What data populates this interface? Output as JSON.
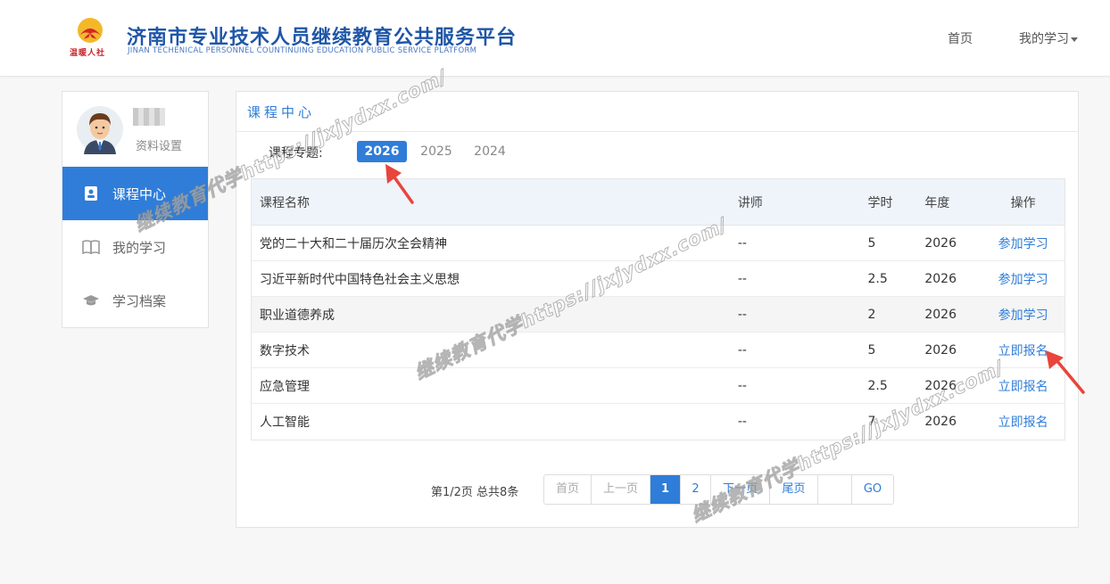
{
  "header": {
    "site_title": "济南市专业技术人员继续教育公共服务平台",
    "site_subtitle": "JINAN TECHENICAL PERSONNEL COUNTINUING EDUCATION PUBLIC SERVICE PLATFORM",
    "logo_text": "温暖人社",
    "nav": {
      "home": "首页",
      "my_study": "我的学习"
    }
  },
  "sidebar": {
    "profile_settings": "资料设置",
    "items": [
      {
        "label": "课程中心",
        "icon": "contact-card-icon",
        "active": true
      },
      {
        "label": "我的学习",
        "icon": "open-book-icon",
        "active": false
      },
      {
        "label": "学习档案",
        "icon": "graduation-cap-icon",
        "active": false
      }
    ]
  },
  "main": {
    "panel_title": "课程中心",
    "topic_label": "课程专题:",
    "years": [
      "2026",
      "2025",
      "2024"
    ],
    "selected_year": "2026",
    "table": {
      "headers": [
        "课程名称",
        "讲师",
        "学时",
        "年度",
        "操作"
      ],
      "rows": [
        {
          "name": "党的二十大和二十届历次全会精神",
          "teacher": "--",
          "hours": "5",
          "year": "2026",
          "action": "参加学习"
        },
        {
          "name": "习近平新时代中国特色社会主义思想",
          "teacher": "--",
          "hours": "2.5",
          "year": "2026",
          "action": "参加学习"
        },
        {
          "name": "职业道德养成",
          "teacher": "--",
          "hours": "2",
          "year": "2026",
          "action": "参加学习"
        },
        {
          "name": "数字技术",
          "teacher": "--",
          "hours": "5",
          "year": "2026",
          "action": "立即报名"
        },
        {
          "name": "应急管理",
          "teacher": "--",
          "hours": "2.5",
          "year": "2026",
          "action": "立即报名"
        },
        {
          "name": "人工智能",
          "teacher": "--",
          "hours": "7",
          "year": "2026",
          "action": "立即报名"
        }
      ]
    },
    "pagination": {
      "info": "第1/2页 总共8条",
      "first": "首页",
      "prev": "上一页",
      "pages": [
        "1",
        "2"
      ],
      "current_page": "1",
      "next": "下一页",
      "last": "尾页",
      "go": "GO"
    }
  },
  "watermark": {
    "text": "继续教育代学https://jxjydxx.com/"
  },
  "colors": {
    "brand_blue": "#1f56a8",
    "accent_blue": "#2f7dd9",
    "arrow_red": "#e8453c"
  }
}
